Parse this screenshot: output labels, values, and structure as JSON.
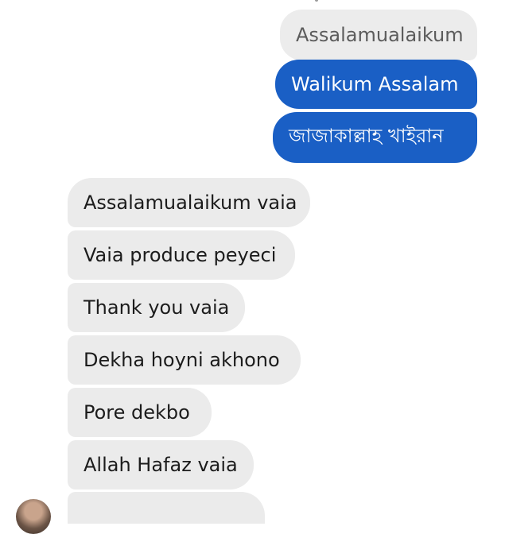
{
  "conversation": {
    "sent": [
      {
        "text": "Assalamualaikum"
      },
      {
        "text": "Walikum Assalam"
      },
      {
        "text": "জাজাকাল্লাহ খাইরান"
      }
    ],
    "received": [
      {
        "text": "Assalamualaikum vaia"
      },
      {
        "text": "Vaia produce peyeci"
      },
      {
        "text": "Thank you vaia"
      },
      {
        "text": "Dekha hoyni akhono"
      },
      {
        "text": "Pore dekbo"
      },
      {
        "text": "Allah Hafaz vaia"
      },
      {
        "text": ""
      }
    ]
  },
  "colors": {
    "sent_accent": "#1a5fc5",
    "sent_grey": "#ececec",
    "received_bg": "#ebebeb",
    "page_bg": "#ffffff"
  },
  "icons": {
    "contact_avatar": "avatar"
  }
}
